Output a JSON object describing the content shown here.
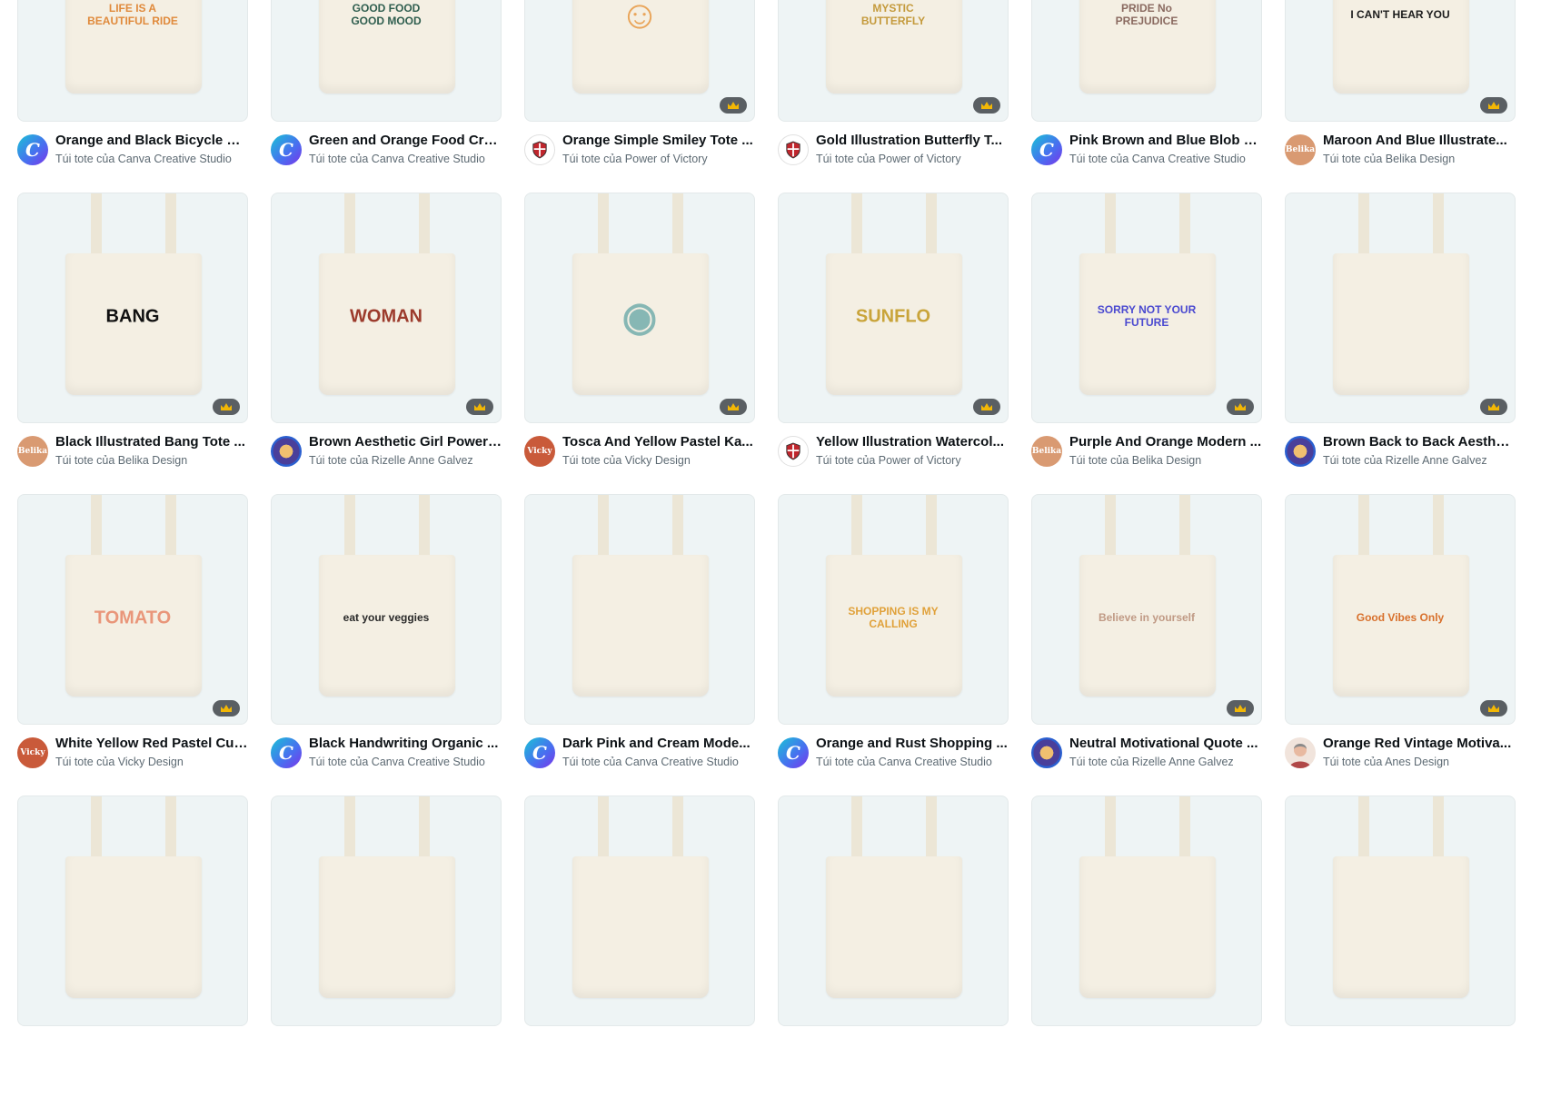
{
  "colors": {
    "card_bg": "#eef4f5",
    "crown_bg": "#5a5f63",
    "crown": "#f2b705",
    "title": "#0d1216",
    "subtitle": "#5d6a73"
  },
  "cards": [
    {
      "title": "Orange and Black Bicycle Cl...",
      "author": "Túi tote của Canva Creative Studio",
      "avatar": "canva",
      "avatar_text": "C",
      "art": "LIFE IS A BEAUTIFUL RIDE",
      "art_color": "#e08a3c",
      "premium": false
    },
    {
      "title": "Green and Orange Food Cra...",
      "author": "Túi tote của Canva Creative Studio",
      "avatar": "canva",
      "avatar_text": "C",
      "art": "GOOD FOOD GOOD MOOD",
      "art_color": "#2f5e4f",
      "premium": false
    },
    {
      "title": "Orange Simple Smiley Tote ...",
      "author": "Túi tote của Power of Victory",
      "avatar": "victory",
      "avatar_text": "",
      "art": "☺",
      "art_color": "#e9a55a",
      "premium": true
    },
    {
      "title": "Gold Illustration Butterfly T...",
      "author": "Túi tote của Power of Victory",
      "avatar": "victory",
      "avatar_text": "",
      "art": "MYSTIC BUTTERFLY",
      "art_color": "#c49a3c",
      "premium": true
    },
    {
      "title": "Pink Brown and Blue Blob D...",
      "author": "Túi tote của Canva Creative Studio",
      "avatar": "canva",
      "avatar_text": "C",
      "art": "PRIDE No PREJUDICE",
      "art_color": "#8a6a60",
      "premium": false
    },
    {
      "title": "Maroon And Blue Illustrate...",
      "author": "Túi tote của Belika Design",
      "avatar": "belika",
      "avatar_text": "Belika",
      "art": "I CAN'T HEAR YOU",
      "art_color": "#1c1c1c",
      "premium": true
    },
    {
      "title": "Black Illustrated Bang Tote ...",
      "author": "Túi tote của Belika Design",
      "avatar": "belika",
      "avatar_text": "Belika",
      "art": "BANG",
      "art_color": "#111111",
      "premium": true
    },
    {
      "title": "Brown Aesthetic Girl Power ...",
      "author": "Túi tote của Rizelle Anne Galvez",
      "avatar": "rizelle",
      "avatar_text": "",
      "art": "WOMAN",
      "art_color": "#9c3b2c",
      "premium": true
    },
    {
      "title": "Tosca And Yellow Pastel Ka...",
      "author": "Túi tote của Vicky Design",
      "avatar": "vicky",
      "avatar_text": "Vicky",
      "art": "◉",
      "art_color": "#86b7b4",
      "premium": true
    },
    {
      "title": "Yellow Illustration Watercol...",
      "author": "Túi tote của Power of Victory",
      "avatar": "victory",
      "avatar_text": "",
      "art": "SUNFLO",
      "art_color": "#c9a43a",
      "premium": true
    },
    {
      "title": "Purple And Orange Modern ...",
      "author": "Túi tote của Belika Design",
      "avatar": "belika",
      "avatar_text": "Belika",
      "art": "SORRY NOT YOUR FUTURE",
      "art_color": "#4a49d0",
      "premium": true
    },
    {
      "title": "Brown Back to Back Aesthet...",
      "author": "Túi tote của Rizelle Anne Galvez",
      "avatar": "rizelle",
      "avatar_text": "",
      "art": "",
      "art_color": "#a8998e",
      "premium": true
    },
    {
      "title": "White Yellow Red Pastel Cut...",
      "author": "Túi tote của Vicky Design",
      "avatar": "vicky",
      "avatar_text": "Vicky",
      "art": "TOMATO",
      "art_color": "#e9967a",
      "premium": true
    },
    {
      "title": "Black Handwriting Organic ...",
      "author": "Túi tote của Canva Creative Studio",
      "avatar": "canva",
      "avatar_text": "C",
      "art": "eat your veggies",
      "art_color": "#2a2a2a",
      "premium": false
    },
    {
      "title": "Dark Pink and Cream Mode...",
      "author": "Túi tote của Canva Creative Studio",
      "avatar": "canva",
      "avatar_text": "C",
      "art": "",
      "art_color": "#c73b6a",
      "premium": false
    },
    {
      "title": "Orange and Rust Shopping ...",
      "author": "Túi tote của Canva Creative Studio",
      "avatar": "canva",
      "avatar_text": "C",
      "art": "SHOPPING IS MY CALLING",
      "art_color": "#e0a13a",
      "premium": false
    },
    {
      "title": "Neutral Motivational Quote ...",
      "author": "Túi tote của Rizelle Anne Galvez",
      "avatar": "rizelle",
      "avatar_text": "",
      "art": "Believe in yourself",
      "art_color": "#c09a85",
      "premium": true
    },
    {
      "title": "Orange Red Vintage Motiva...",
      "author": "Túi tote của Anes Design",
      "avatar": "anes",
      "avatar_text": "",
      "art": "Good Vibes Only",
      "art_color": "#d8702c",
      "premium": true
    },
    {
      "title": "",
      "author": "",
      "avatar": "none",
      "avatar_text": "",
      "art": "",
      "art_color": "#eeeeee",
      "premium": false
    },
    {
      "title": "",
      "author": "",
      "avatar": "none",
      "avatar_text": "",
      "art": "",
      "art_color": "#eeeeee",
      "premium": false
    },
    {
      "title": "",
      "author": "",
      "avatar": "none",
      "avatar_text": "",
      "art": "",
      "art_color": "#eeeeee",
      "premium": false
    },
    {
      "title": "",
      "author": "",
      "avatar": "none",
      "avatar_text": "",
      "art": "",
      "art_color": "#eeeeee",
      "premium": false
    },
    {
      "title": "",
      "author": "",
      "avatar": "none",
      "avatar_text": "",
      "art": "",
      "art_color": "#eeeeee",
      "premium": false
    },
    {
      "title": "",
      "author": "",
      "avatar": "none",
      "avatar_text": "",
      "art": "",
      "art_color": "#eeeeee",
      "premium": false
    }
  ]
}
